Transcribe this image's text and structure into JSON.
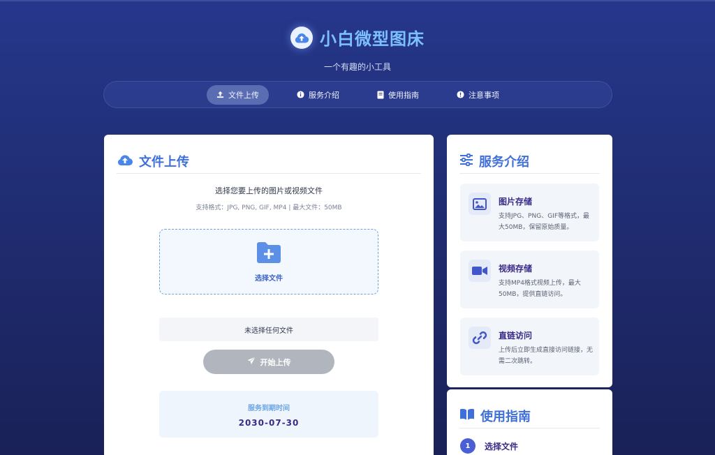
{
  "app": {
    "title": "小白微型图床",
    "tagline": "一个有趣的小工具"
  },
  "nav": [
    {
      "label": "文件上传",
      "icon": "upload-icon",
      "active": true
    },
    {
      "label": "服务介绍",
      "icon": "info-icon",
      "active": false
    },
    {
      "label": "使用指南",
      "icon": "book-icon",
      "active": false
    },
    {
      "label": "注意事项",
      "icon": "alert-icon",
      "active": false
    }
  ],
  "upload": {
    "heading": "文件上传",
    "title": "选择您要上传的图片或视频文件",
    "formats": "支持格式：JPG, PNG, GIF, MP4 | 最大文件：50MB",
    "choose_label": "选择文件",
    "no_file": "未选择任何文件",
    "submit_label": "开始上传",
    "expiry_label": "服务到期时间",
    "expiry_date": "2030-07-30"
  },
  "services": {
    "heading": "服务介绍",
    "items": [
      {
        "title": "图片存储",
        "desc": "支持JPG、PNG、GIF等格式，最大50MB，保留原始质量。",
        "icon": "image-icon"
      },
      {
        "title": "视频存储",
        "desc": "支持MP4格式视频上传，最大50MB，提供直链访问。",
        "icon": "video-icon"
      },
      {
        "title": "直链访问",
        "desc": "上传后立即生成直接访问链接，无需二次跳转。",
        "icon": "link-icon"
      }
    ]
  },
  "guide": {
    "heading": "使用指南",
    "steps": [
      {
        "number": "1",
        "label": "选择文件"
      }
    ]
  },
  "colors": {
    "accent": "#3f6fd8",
    "brand": "#7cc0ff",
    "feature_title": "#3a2a88",
    "button_disabled": "#b1b5be"
  }
}
